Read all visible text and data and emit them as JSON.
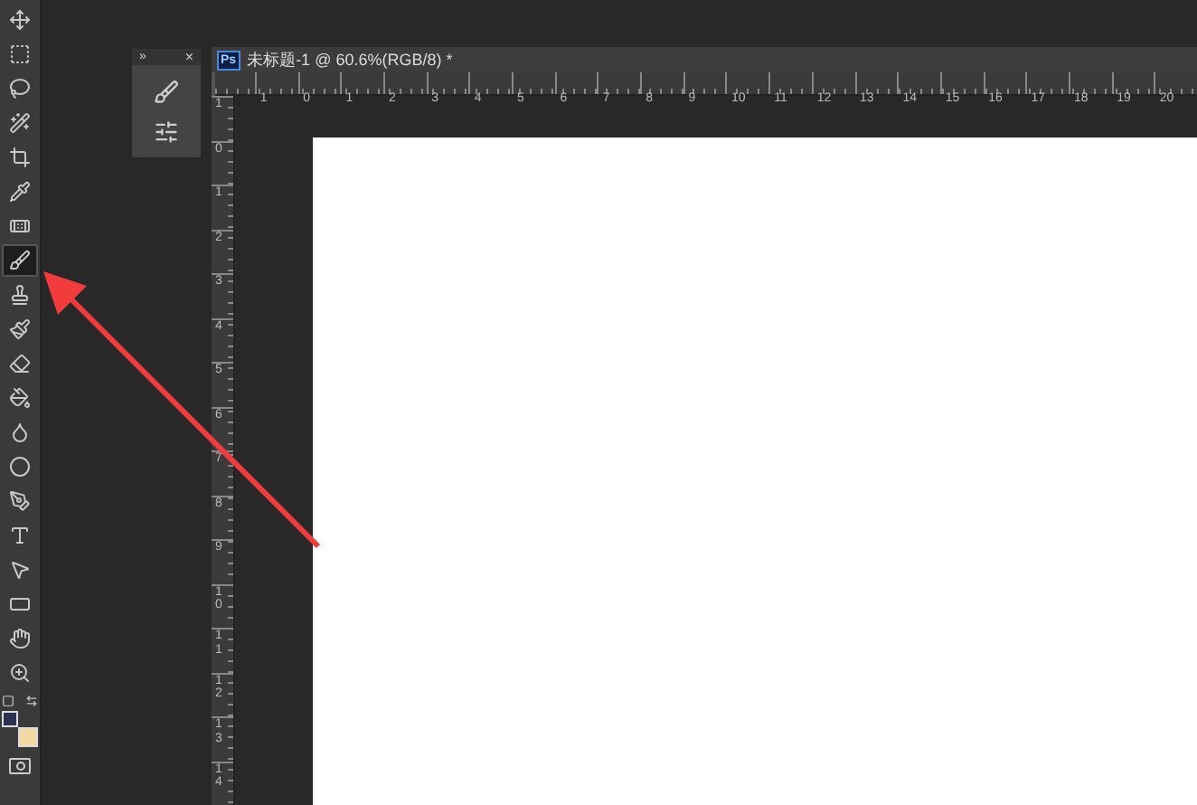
{
  "toolbar": {
    "tools": [
      {
        "kind": "move",
        "selected": false
      },
      {
        "kind": "marquee",
        "selected": false
      },
      {
        "kind": "lasso",
        "selected": false
      },
      {
        "kind": "wand",
        "selected": false
      },
      {
        "kind": "crop",
        "selected": false
      },
      {
        "kind": "eyedropper",
        "selected": false
      },
      {
        "kind": "healing",
        "selected": false
      },
      {
        "kind": "brush",
        "selected": true
      },
      {
        "kind": "stamp",
        "selected": false
      },
      {
        "kind": "history",
        "selected": false
      },
      {
        "kind": "eraser",
        "selected": false
      },
      {
        "kind": "bucket",
        "selected": false
      },
      {
        "kind": "blur",
        "selected": false
      },
      {
        "kind": "dodge",
        "selected": false
      },
      {
        "kind": "pen",
        "selected": false
      },
      {
        "kind": "type",
        "selected": false
      },
      {
        "kind": "path",
        "selected": false
      },
      {
        "kind": "shape",
        "selected": false
      },
      {
        "kind": "hand",
        "selected": false
      },
      {
        "kind": "zoom",
        "selected": false
      }
    ],
    "swatches": [
      {
        "kind": "foreground",
        "color": "#2c3352"
      },
      {
        "kind": "background",
        "color": "#f2d9a4"
      }
    ]
  },
  "panel": {
    "collapse": "»",
    "close": "×"
  },
  "document": {
    "badge": "Ps",
    "title": "未标题-1 @ 60.6%(RGB/8) *",
    "h_ruler": [
      "1",
      "0",
      "1",
      "2",
      "3",
      "4",
      "5",
      "6",
      "7",
      "8",
      "9",
      "10",
      "11",
      "12",
      "13",
      "14",
      "15",
      "16",
      "17",
      "18",
      "19",
      "20"
    ],
    "v_ruler": [
      "1",
      "0",
      "1",
      "2",
      "3",
      "4",
      "5",
      "6",
      "7",
      "8",
      "9",
      "10",
      "11",
      "12",
      "13",
      "14"
    ]
  }
}
